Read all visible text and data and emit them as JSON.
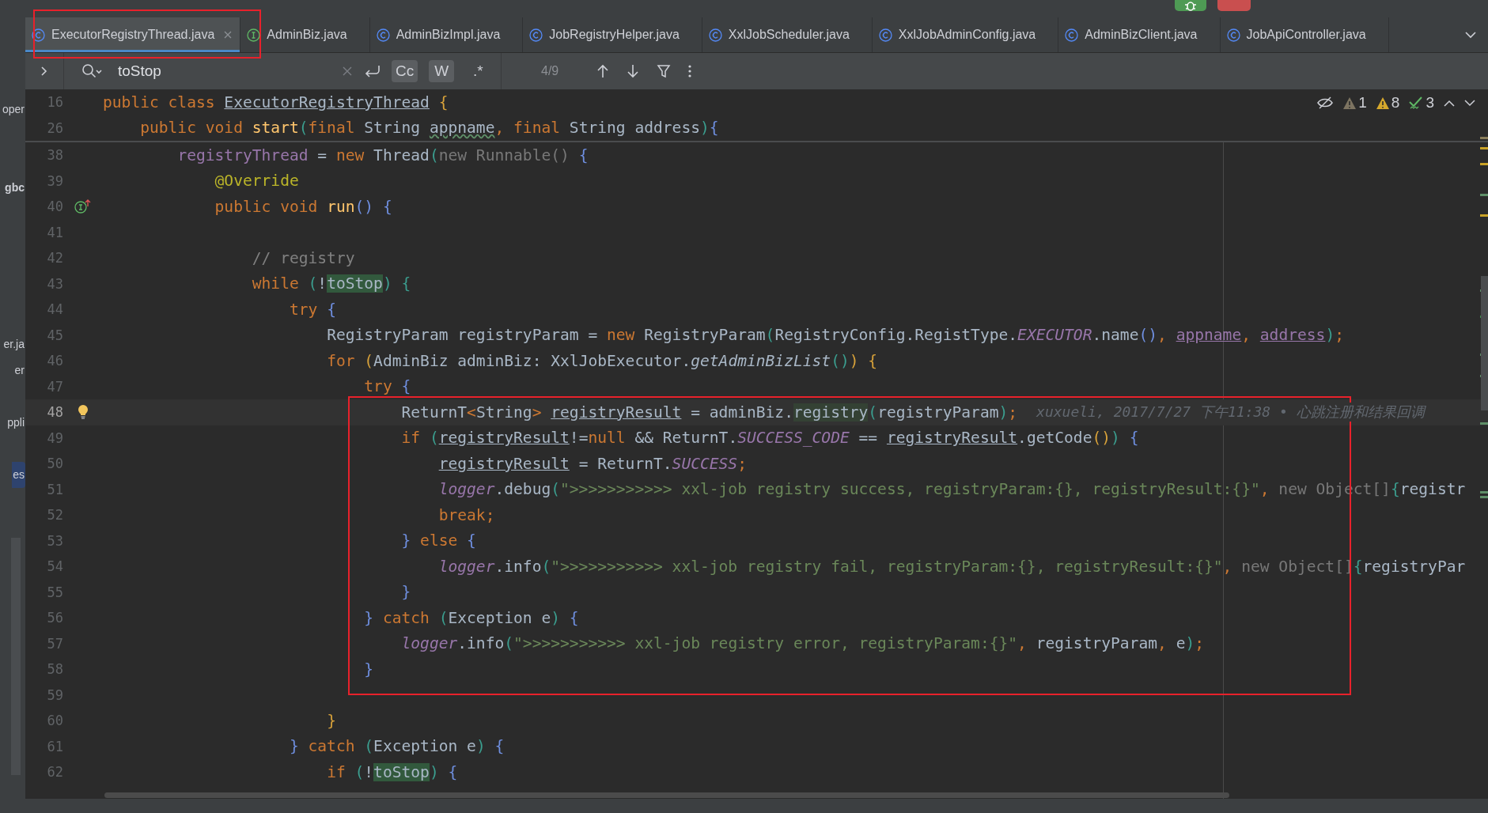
{
  "project_panel": [
    {
      "label": "oper",
      "kind": "file",
      "selected": false
    },
    {
      "label": "gbc",
      "kind": "module",
      "selected": false
    },
    {
      "label": "er.ja",
      "kind": "file",
      "selected": false
    },
    {
      "label": "er",
      "kind": "file",
      "selected": false
    },
    {
      "label": "ppli",
      "kind": "file",
      "selected": false
    },
    {
      "label": "es",
      "kind": "file",
      "selected": true
    }
  ],
  "tabs": [
    {
      "label": "ExecutorRegistryThread.java",
      "kind": "class",
      "selected": true,
      "boxed": true
    },
    {
      "label": "AdminBiz.java",
      "kind": "interface",
      "selected": false,
      "boxed": false
    },
    {
      "label": "AdminBizImpl.java",
      "kind": "class",
      "selected": false,
      "boxed": false
    },
    {
      "label": "JobRegistryHelper.java",
      "kind": "class",
      "selected": false,
      "boxed": false
    },
    {
      "label": "XxlJobScheduler.java",
      "kind": "class",
      "selected": false,
      "boxed": false
    },
    {
      "label": "XxlJobAdminConfig.java",
      "kind": "class",
      "selected": false,
      "boxed": false
    },
    {
      "label": "AdminBizClient.java",
      "kind": "class",
      "selected": false,
      "boxed": false
    },
    {
      "label": "JobApiController.java",
      "kind": "class",
      "selected": false,
      "boxed": false
    }
  ],
  "find_bar": {
    "query": "toStop",
    "options": [
      {
        "label": "Cc",
        "selected": true
      },
      {
        "label": "W",
        "selected": true
      },
      {
        "label": ".*",
        "selected": false
      }
    ],
    "count": "4/9"
  },
  "inspections": [
    {
      "kind": "weak-warning",
      "count": "1"
    },
    {
      "kind": "warning",
      "count": "8"
    },
    {
      "kind": "typo",
      "count": "3"
    }
  ],
  "sticky_lines": [
    {
      "number": "16",
      "tokens": [
        {
          "text": "public class ",
          "kind": "kw"
        },
        {
          "text": "ExecutorRegistryThread",
          "kind": "ul"
        },
        {
          "text": " {",
          "kind": "p3"
        }
      ]
    },
    {
      "number": "26",
      "tokens": [
        {
          "text": "    public void ",
          "kind": "kw"
        },
        {
          "text": "start",
          "kind": "fn"
        },
        {
          "text": "(",
          "kind": "p2"
        },
        {
          "text": "final ",
          "kind": "kw"
        },
        {
          "text": "String ",
          "kind": "pl"
        },
        {
          "text": "appname",
          "kind": "typo"
        },
        {
          "text": ", ",
          "kind": "kw"
        },
        {
          "text": "final ",
          "kind": "kw"
        },
        {
          "text": "String address",
          "kind": "pl"
        },
        {
          "text": ")",
          "kind": "p2"
        },
        {
          "text": "{",
          "kind": "p1"
        }
      ]
    }
  ],
  "lines": [
    {
      "number": "38",
      "current": false,
      "boxed": false,
      "tokens": [
        {
          "text": "        registryThread",
          "kind": "fd"
        },
        {
          "text": " = ",
          "kind": "pl"
        },
        {
          "text": "new ",
          "kind": "kw"
        },
        {
          "text": "Thread",
          "kind": "pl"
        },
        {
          "text": "(",
          "kind": "p2"
        },
        {
          "text": "new Runnable() ",
          "kind": "dim"
        },
        {
          "text": "{",
          "kind": "p1"
        }
      ]
    },
    {
      "number": "39",
      "current": false,
      "boxed": false,
      "tokens": [
        {
          "text": "            @Override",
          "kind": "an"
        }
      ]
    },
    {
      "number": "40",
      "current": false,
      "boxed": false,
      "gutter": {
        "kind": "implements"
      },
      "tokens": [
        {
          "text": "            public void ",
          "kind": "kw"
        },
        {
          "text": "run",
          "kind": "fn"
        },
        {
          "text": "() {",
          "kind": "p1"
        }
      ]
    },
    {
      "number": "41",
      "current": false,
      "boxed": false
    },
    {
      "number": "42",
      "current": false,
      "boxed": false,
      "tokens": [
        {
          "text": "                // registry",
          "kind": "cm"
        }
      ]
    },
    {
      "number": "43",
      "current": false,
      "boxed": false,
      "tokens": [
        {
          "text": "                while ",
          "kind": "kw"
        },
        {
          "text": "(",
          "kind": "p2"
        },
        {
          "text": "!",
          "kind": "pl"
        },
        {
          "text": "toStop",
          "kind": "match"
        },
        {
          "text": ") {",
          "kind": "p2"
        }
      ]
    },
    {
      "number": "44",
      "current": false,
      "boxed": false,
      "tokens": [
        {
          "text": "                    try ",
          "kind": "kw"
        },
        {
          "text": "{",
          "kind": "p1"
        }
      ]
    },
    {
      "number": "45",
      "current": false,
      "boxed": false,
      "tokens": [
        {
          "text": "                        RegistryParam registryParam = ",
          "kind": "pl"
        },
        {
          "text": "new ",
          "kind": "kw"
        },
        {
          "text": "RegistryParam",
          "kind": "pl"
        },
        {
          "text": "(",
          "kind": "p2"
        },
        {
          "text": "RegistryConfig.RegistType.",
          "kind": "pl"
        },
        {
          "text": "EXECUTOR",
          "kind": "st"
        },
        {
          "text": ".name",
          "kind": "pl"
        },
        {
          "text": "()",
          "kind": "p1"
        },
        {
          "text": ", ",
          "kind": "kw"
        },
        {
          "text": "appname",
          "kind": "pu"
        },
        {
          "text": ", ",
          "kind": "kw"
        },
        {
          "text": "address",
          "kind": "pu"
        },
        {
          "text": ")",
          "kind": "p2"
        },
        {
          "text": ";",
          "kind": "kw"
        }
      ]
    },
    {
      "number": "46",
      "current": false,
      "boxed": false,
      "tokens": [
        {
          "text": "                        for ",
          "kind": "kw"
        },
        {
          "text": "(",
          "kind": "p3"
        },
        {
          "text": "AdminBiz adminBiz: XxlJobExecutor.",
          "kind": "pl"
        },
        {
          "text": "getAdminBizList",
          "kind": "it"
        },
        {
          "text": "()",
          "kind": "p2"
        },
        {
          "text": ") {",
          "kind": "p3"
        }
      ]
    },
    {
      "number": "47",
      "current": false,
      "boxed": false,
      "tokens": [
        {
          "text": "                            try ",
          "kind": "kw"
        },
        {
          "text": "{",
          "kind": "p1"
        }
      ]
    },
    {
      "number": "48",
      "current": true,
      "boxed": true,
      "gutter": {
        "kind": "bulb"
      },
      "blame": "xuxueli, 2017/7/27 下午11:38 • 心跳注册和结果回调",
      "tokens": [
        {
          "text": "                                ReturnT",
          "kind": "pl"
        },
        {
          "text": "<",
          "kind": "kw"
        },
        {
          "text": "String",
          "kind": "pl"
        },
        {
          "text": "> ",
          "kind": "kw"
        },
        {
          "text": "registryResult",
          "kind": "ul"
        },
        {
          "text": " = adminBiz.",
          "kind": "pl"
        },
        {
          "text": "registry",
          "kind": "occ"
        },
        {
          "text": "(",
          "kind": "p2"
        },
        {
          "text": "registryParam",
          "kind": "pl"
        },
        {
          "text": ")",
          "kind": "p2"
        },
        {
          "text": ";",
          "kind": "kw"
        }
      ]
    },
    {
      "number": "49",
      "current": false,
      "boxed": true,
      "tokens": [
        {
          "text": "                                if ",
          "kind": "kw"
        },
        {
          "text": "(",
          "kind": "p2"
        },
        {
          "text": "registryResult",
          "kind": "ul"
        },
        {
          "text": "!=",
          "kind": "pl"
        },
        {
          "text": "null",
          "kind": "kw"
        },
        {
          "text": " && ReturnT.",
          "kind": "pl"
        },
        {
          "text": "SUCCESS_CODE",
          "kind": "st"
        },
        {
          "text": " == ",
          "kind": "pl"
        },
        {
          "text": "registryResult",
          "kind": "ul"
        },
        {
          "text": ".getCode",
          "kind": "pl"
        },
        {
          "text": "()",
          "kind": "p3"
        },
        {
          "text": ")",
          "kind": "p2"
        },
        {
          "text": " {",
          "kind": "p1"
        }
      ]
    },
    {
      "number": "50",
      "current": false,
      "boxed": true,
      "tokens": [
        {
          "text": "                                    registryResult",
          "kind": "ul"
        },
        {
          "text": " = ReturnT.",
          "kind": "pl"
        },
        {
          "text": "SUCCESS",
          "kind": "st"
        },
        {
          "text": ";",
          "kind": "kw"
        }
      ]
    },
    {
      "number": "51",
      "current": false,
      "boxed": true,
      "tokens": [
        {
          "text": "                                    logger",
          "kind": "st"
        },
        {
          "text": ".debug",
          "kind": "pl"
        },
        {
          "text": "(",
          "kind": "p2"
        },
        {
          "text": "\">>>>>>>>>>> xxl-job registry success, registryParam:{}, registryResult:{}\"",
          "kind": "str"
        },
        {
          "text": ", ",
          "kind": "kw"
        },
        {
          "text": "new Object[]",
          "kind": "dim"
        },
        {
          "text": "{",
          "kind": "p2"
        },
        {
          "text": "registr",
          "kind": "pl"
        }
      ]
    },
    {
      "number": "52",
      "current": false,
      "boxed": true,
      "tokens": [
        {
          "text": "                                    break;",
          "kind": "kw"
        }
      ]
    },
    {
      "number": "53",
      "current": false,
      "boxed": true,
      "tokens": [
        {
          "text": "                                } ",
          "kind": "p1"
        },
        {
          "text": "else ",
          "kind": "kw"
        },
        {
          "text": "{",
          "kind": "p1"
        }
      ]
    },
    {
      "number": "54",
      "current": false,
      "boxed": true,
      "tokens": [
        {
          "text": "                                    logger",
          "kind": "st"
        },
        {
          "text": ".info",
          "kind": "pl"
        },
        {
          "text": "(",
          "kind": "p2"
        },
        {
          "text": "\">>>>>>>>>>> xxl-job registry fail, registryParam:{}, registryResult:{}\"",
          "kind": "str"
        },
        {
          "text": ", ",
          "kind": "kw"
        },
        {
          "text": "new Object[]",
          "kind": "dim"
        },
        {
          "text": "{",
          "kind": "p2"
        },
        {
          "text": "registryPar",
          "kind": "pl"
        }
      ]
    },
    {
      "number": "55",
      "current": false,
      "boxed": true,
      "tokens": [
        {
          "text": "                                }",
          "kind": "p1"
        }
      ]
    },
    {
      "number": "56",
      "current": false,
      "boxed": true,
      "tokens": [
        {
          "text": "                            } ",
          "kind": "p1"
        },
        {
          "text": "catch ",
          "kind": "kw"
        },
        {
          "text": "(",
          "kind": "p2"
        },
        {
          "text": "Exception e",
          "kind": "pl"
        },
        {
          "text": ")",
          "kind": "p2"
        },
        {
          "text": " {",
          "kind": "p1"
        }
      ]
    },
    {
      "number": "57",
      "current": false,
      "boxed": true,
      "tokens": [
        {
          "text": "                                logger",
          "kind": "st"
        },
        {
          "text": ".info",
          "kind": "pl"
        },
        {
          "text": "(",
          "kind": "p2"
        },
        {
          "text": "\">>>>>>>>>>> xxl-job registry error, registryParam:{}\"",
          "kind": "str"
        },
        {
          "text": ", ",
          "kind": "kw"
        },
        {
          "text": "registryParam",
          "kind": "pl"
        },
        {
          "text": ", ",
          "kind": "kw"
        },
        {
          "text": "e",
          "kind": "pl"
        },
        {
          "text": ")",
          "kind": "p2"
        },
        {
          "text": ";",
          "kind": "kw"
        }
      ]
    },
    {
      "number": "58",
      "current": false,
      "boxed": true,
      "tokens": [
        {
          "text": "                            }",
          "kind": "p1"
        }
      ]
    },
    {
      "number": "59",
      "current": false,
      "boxed": false
    },
    {
      "number": "60",
      "current": false,
      "boxed": false,
      "tokens": [
        {
          "text": "                        }",
          "kind": "p3"
        }
      ]
    },
    {
      "number": "61",
      "current": false,
      "boxed": false,
      "tokens": [
        {
          "text": "                    } ",
          "kind": "p1"
        },
        {
          "text": "catch ",
          "kind": "kw"
        },
        {
          "text": "(",
          "kind": "p2"
        },
        {
          "text": "Exception e",
          "kind": "pl"
        },
        {
          "text": ")",
          "kind": "p2"
        },
        {
          "text": " {",
          "kind": "p1"
        }
      ]
    },
    {
      "number": "62",
      "current": false,
      "boxed": false,
      "tokens": [
        {
          "text": "                        if ",
          "kind": "kw"
        },
        {
          "text": "(",
          "kind": "p2"
        },
        {
          "text": "!",
          "kind": "pl"
        },
        {
          "text": "toStop",
          "kind": "match"
        },
        {
          "text": ")",
          "kind": "p2"
        },
        {
          "text": " {",
          "kind": "p1"
        }
      ]
    }
  ]
}
